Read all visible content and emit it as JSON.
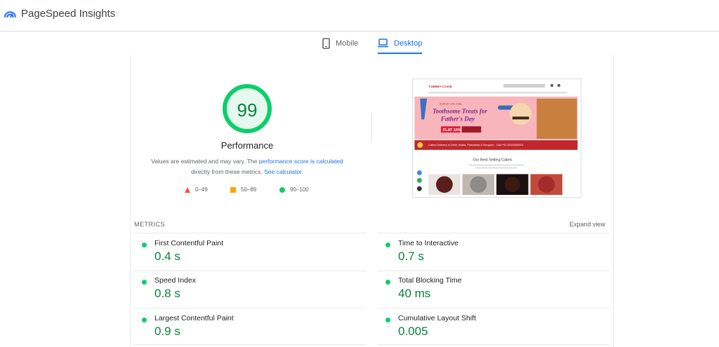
{
  "app": {
    "title": "PageSpeed Insights"
  },
  "tabs": [
    {
      "label": "Mobile",
      "icon": "phone-icon",
      "active": false
    },
    {
      "label": "Desktop",
      "icon": "laptop-icon",
      "active": true
    }
  ],
  "performance": {
    "score": "99",
    "score_fraction": 0.99,
    "title": "Performance",
    "desc_part1": "Values are estimated and may vary. The ",
    "desc_link1": "performance score is calculated",
    "desc_part2": " directly from these metrics. ",
    "desc_link2": "See calculator."
  },
  "legend": [
    {
      "range": "0–49",
      "shape": "triangle",
      "color": "#ff4e42"
    },
    {
      "range": "50–89",
      "shape": "square",
      "color": "#ffa400"
    },
    {
      "range": "90–100",
      "shape": "circle",
      "color": "#0cce6b"
    }
  ],
  "screenshot": {
    "brand": "YUMMY CAKE",
    "event_date": "SUNDAY 19th JUNE",
    "headline_1": "Toothsome Treats for",
    "headline_2": "Father's Day",
    "offer": "FLAT 10%",
    "delivery": "Cakes Delivery in Delhi, Noida, Faridabad & Gurgaon - Call +91-9319262519",
    "section_title": "Our Best Selling Cakes"
  },
  "metrics": {
    "label": "METRICS",
    "expand_label": "Expand view",
    "left": [
      {
        "name": "First Contentful Paint",
        "value": "0.4 s"
      },
      {
        "name": "Speed Index",
        "value": "0.8 s"
      },
      {
        "name": "Largest Contentful Paint",
        "value": "0.9 s"
      }
    ],
    "right": [
      {
        "name": "Time to Interactive",
        "value": "0.7 s"
      },
      {
        "name": "Total Blocking Time",
        "value": "40 ms"
      },
      {
        "name": "Cumulative Layout Shift",
        "value": "0.005"
      }
    ]
  },
  "colors": {
    "pass": "#0cce6b",
    "pass_text": "#0b8043",
    "accent": "#1a73e8",
    "average": "#ffa400",
    "fail": "#ff4e42"
  }
}
